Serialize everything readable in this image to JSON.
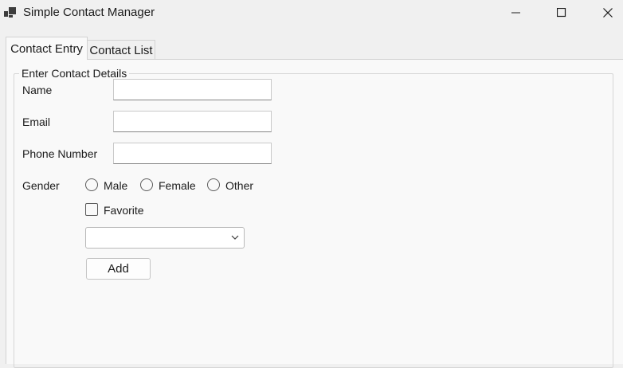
{
  "window": {
    "title": "Simple Contact Manager",
    "icons": {
      "app": "app-icon",
      "minimize": "minimize-icon",
      "maximize": "maximize-icon",
      "close": "close-icon"
    }
  },
  "tabs": [
    {
      "label": "Contact Entry",
      "selected": true
    },
    {
      "label": "Contact List",
      "selected": false
    }
  ],
  "form": {
    "group_title": "Enter Contact Details",
    "name_label": "Name",
    "name_value": "",
    "email_label": "Email",
    "email_value": "",
    "phone_label": "Phone Number",
    "phone_value": "",
    "gender_label": "Gender",
    "gender_options": [
      "Male",
      "Female",
      "Other"
    ],
    "gender_selected": "",
    "favorite_label": "Favorite",
    "favorite_checked": false,
    "combo_value": "",
    "add_label": "Add"
  }
}
